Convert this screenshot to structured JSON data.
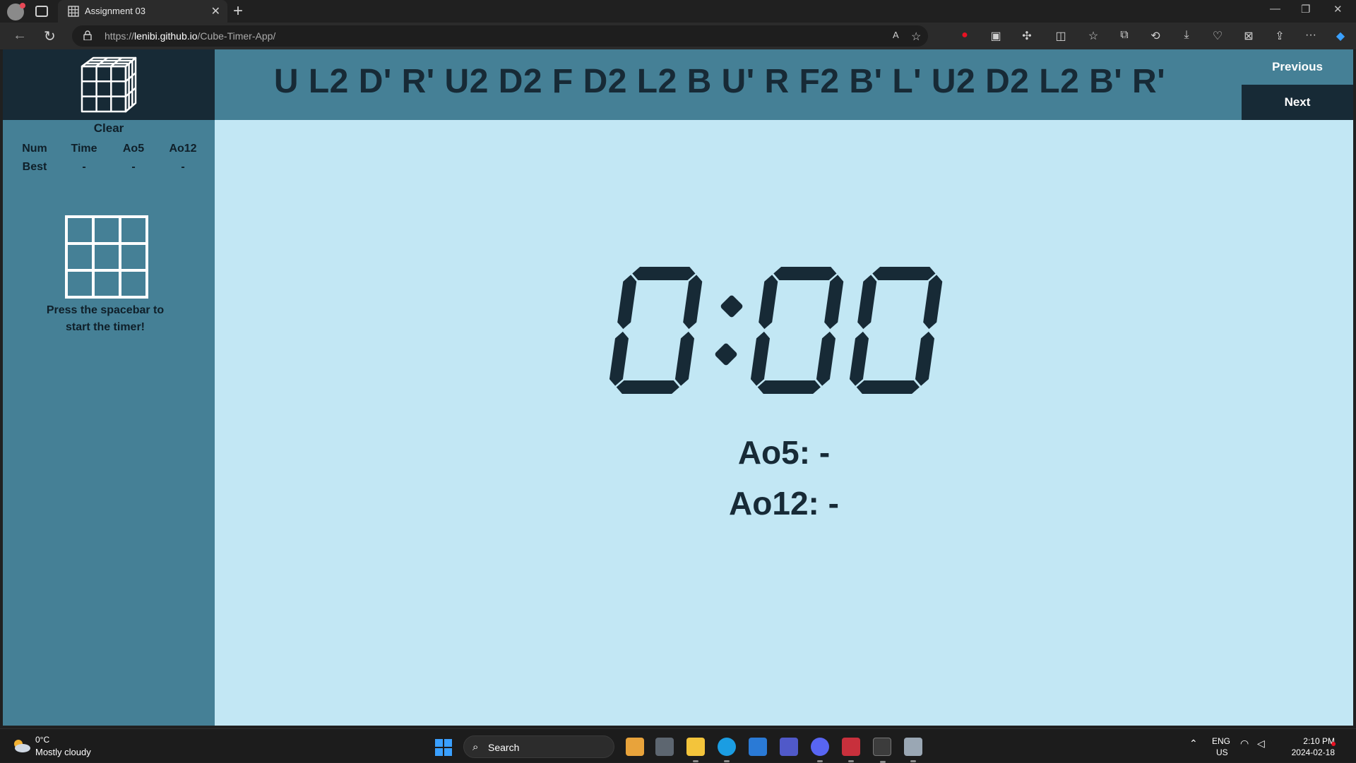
{
  "browser": {
    "tab_title": "Assignment 03",
    "url_domain": "lenibi.github.io",
    "url_scheme": "https://",
    "url_path": "/Cube-Timer-App/"
  },
  "sidebar": {
    "clear_label": "Clear",
    "stats_headers": [
      "Num",
      "Time",
      "Ao5",
      "Ao12"
    ],
    "best_row": [
      "Best",
      "-",
      "-",
      "-"
    ],
    "hint": "Press the spacebar to start the timer!"
  },
  "header": {
    "scramble": "U L2 D' R' U2 D2 F D2 L2 B U' R F2 B' L' U2 D2 L2 B' R'",
    "previous_label": "Previous",
    "next_label": "Next"
  },
  "timer": {
    "display": "0:00",
    "ao5": "Ao5: -",
    "ao12": "Ao12: -"
  },
  "taskbar": {
    "weather_temp": "0°C",
    "weather_desc": "Mostly cloudy",
    "search_label": "Search",
    "lang_1": "ENG",
    "lang_2": "US",
    "time": "2:10 PM",
    "date": "2024-02-18"
  },
  "colors": {
    "app_bg": "#c2e7f4",
    "panel": "#458096",
    "dark": "#172a36"
  }
}
